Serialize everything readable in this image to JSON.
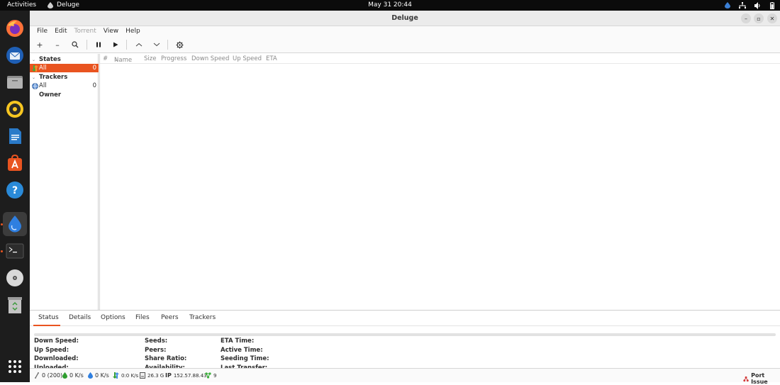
{
  "topbar": {
    "activities": "Activities",
    "app_name": "Deluge",
    "clock": "May 31  20:44"
  },
  "dock": {
    "items": [
      "firefox-icon",
      "thunderbird-icon",
      "files-icon",
      "rhythmbox-icon",
      "writer-icon",
      "software-icon",
      "help-icon",
      "deluge-icon",
      "terminal-icon",
      "disc-icon",
      "trash-icon",
      "app-grid-icon"
    ]
  },
  "window": {
    "title": "Deluge"
  },
  "menu": {
    "file": "File",
    "edit": "Edit",
    "torrent": "Torrent",
    "view": "View",
    "help": "Help"
  },
  "toolbar": {
    "add": "+",
    "remove": "–",
    "search": "⌕",
    "pause": "⏸",
    "resume": "▶",
    "up": "︿",
    "down": "﹀",
    "prefs": "⚙"
  },
  "sidebar": {
    "states_header": "States",
    "states_all": "All",
    "states_all_count": "0",
    "trackers_header": "Trackers",
    "trackers_all": "All",
    "trackers_all_count": "0",
    "owner_header": "Owner"
  },
  "list": {
    "columns": [
      "#",
      "Name",
      "Size",
      "Progress",
      "Down Speed",
      "Up Speed",
      "ETA"
    ]
  },
  "tabs": [
    "Status",
    "Details",
    "Options",
    "Files",
    "Peers",
    "Trackers"
  ],
  "status": {
    "progress": 0,
    "col1": [
      "Down Speed:",
      "Up Speed:",
      "Downloaded:",
      "Uploaded:"
    ],
    "col2": [
      "Seeds:",
      "Peers:",
      "Share Ratio:",
      "Availability:"
    ],
    "col3": [
      "ETA Time:",
      "Active Time:",
      "Seeding Time:",
      "Last Transfer:"
    ]
  },
  "statusbar": {
    "connections": "0 (200)",
    "down": "0 K/s",
    "up": "0 K/s",
    "protocol": "0:0 K/s",
    "disk": "26.3 G",
    "ip_label": "IP",
    "ip": "152.57.88.43",
    "dht": "9",
    "port_issue": "Port Issue"
  },
  "colors": {
    "accent": "#e95420",
    "dock_bg": "#1d1d1d",
    "topbar_bg": "#0b0b0b"
  }
}
